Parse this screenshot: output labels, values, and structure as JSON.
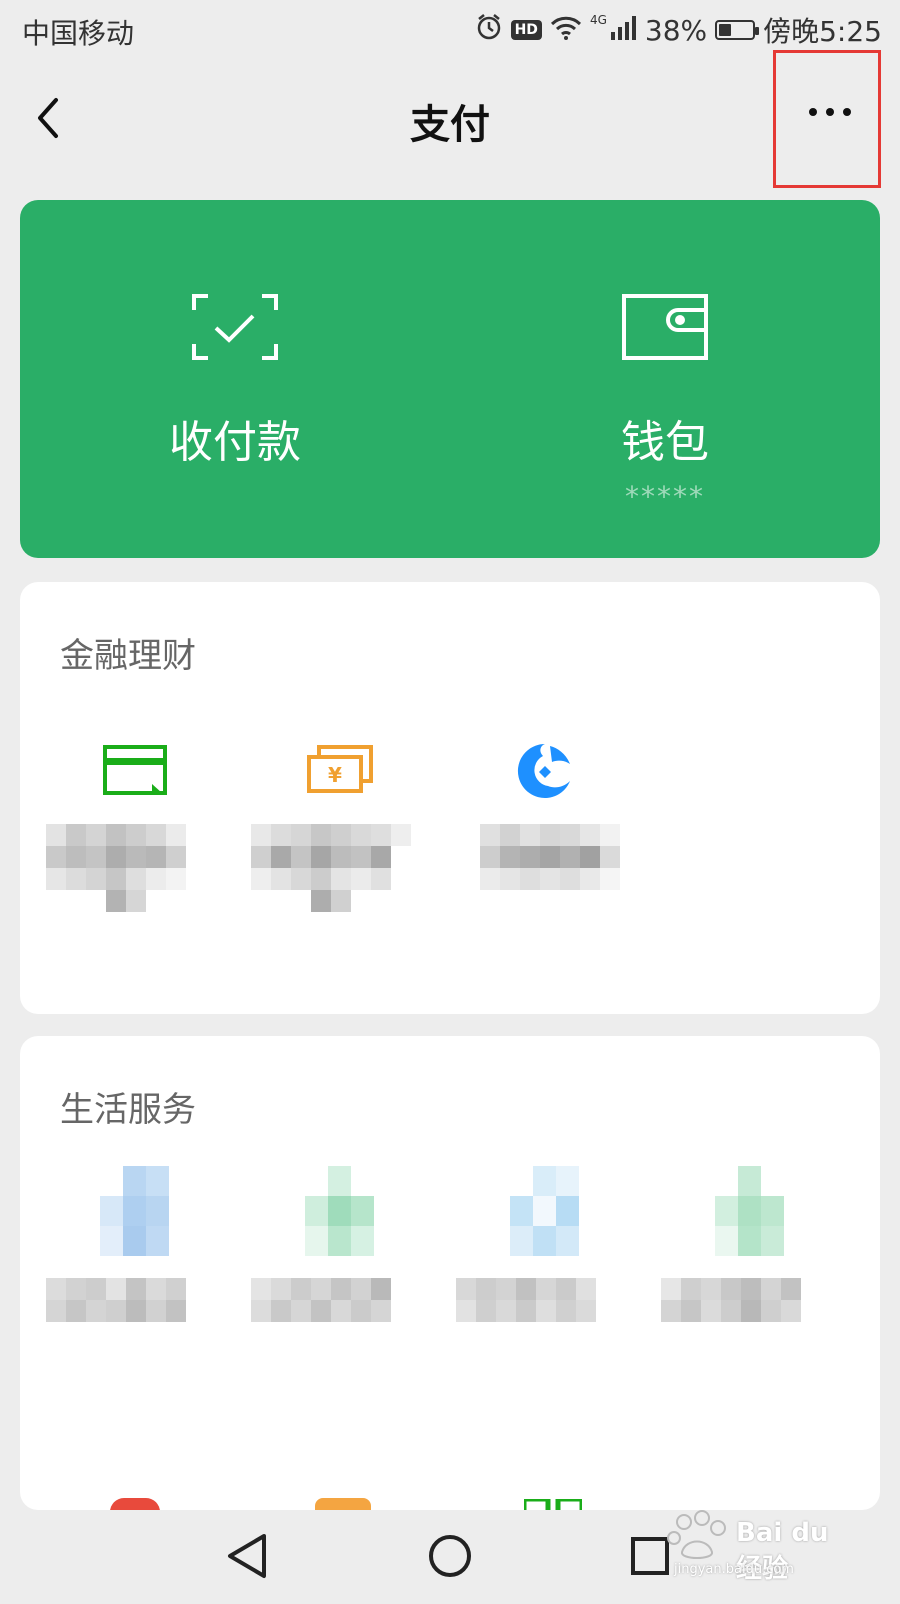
{
  "status_bar": {
    "carrier": "中国移动",
    "hd": "HD",
    "network": "4G",
    "battery": "38%",
    "battery_level": 0.38,
    "time": "傍晚5:25"
  },
  "nav": {
    "title": "支付",
    "back_icon": "chevron-left-icon",
    "more_icon": "more-dots-icon",
    "highlight_color": "#e53935"
  },
  "green_card": {
    "color": "#2aae67",
    "items": [
      {
        "label": "收付款",
        "icon": "scan-check-icon"
      },
      {
        "label": "钱包",
        "sub": "*****",
        "icon": "wallet-icon"
      }
    ]
  },
  "finance": {
    "title": "金融理财",
    "items": [
      {
        "icon": "credit-card-icon",
        "icon_color": "#1aad19"
      },
      {
        "icon": "wealth-icon",
        "icon_color": "#f0a030"
      },
      {
        "icon": "fund-icon",
        "icon_color": "#1e90ff"
      }
    ]
  },
  "life": {
    "title": "生活服务"
  },
  "system_nav": {
    "back_icon": "triangle-back-icon",
    "home_icon": "circle-home-icon",
    "recent_icon": "square-recent-icon"
  },
  "watermark": {
    "brand": "Bai du 经验",
    "url": "jingyan.baidu.com"
  }
}
